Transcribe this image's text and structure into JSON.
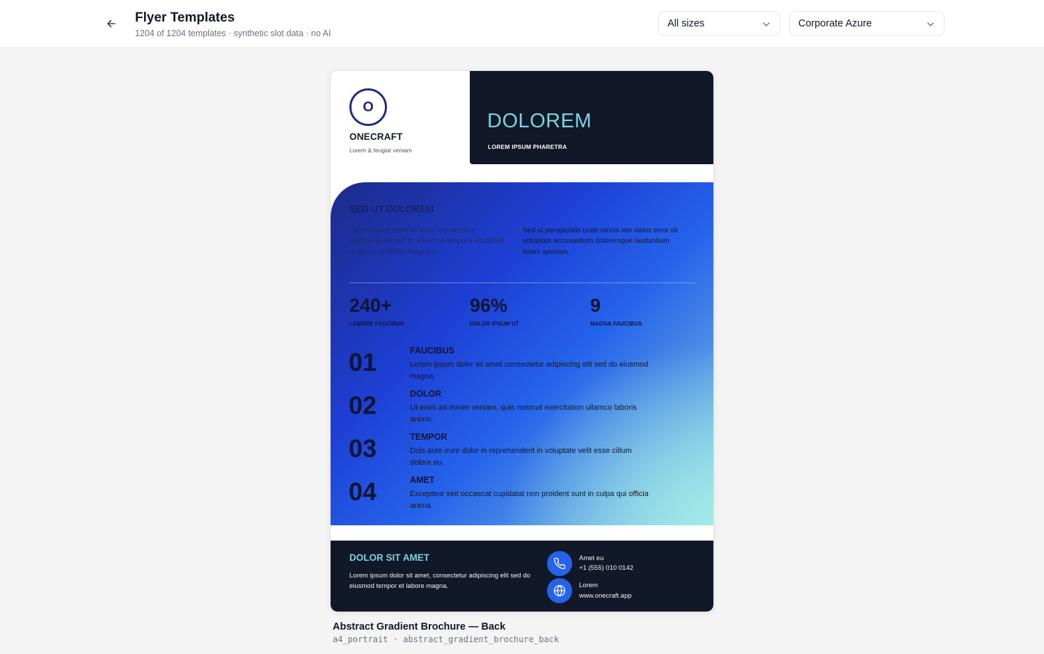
{
  "header": {
    "title": "Flyer Templates",
    "subtitle": "1204 of 1204 templates · synthetic slot data · no AI",
    "size_filter": "All sizes",
    "theme_filter": "Corporate Azure"
  },
  "flyer": {
    "logo_letter": "O",
    "brand_name": "ONECRAFT",
    "brand_tagline": "Lorem & feugiat veniam",
    "hero_title": "DOLOREM",
    "hero_subtitle": "LOREM IPSUM PHARETRA",
    "section_title": "SED UT DOLOREM",
    "section_col1": "Lorem ipsum dolor sit amet, consectetur adipiscing elit sed do eiusmod tempora incididunt ut labore et dolore magnam.",
    "section_col2": "Sed ut perspiciatis unde omnis iste natus error sit voluptate accusantium doloremque laudantium totam aperiam.",
    "stats": [
      {
        "value": "240+",
        "label": "LABORE FAUCIBUS"
      },
      {
        "value": "96%",
        "label": "DOLOR IPSUM UT"
      },
      {
        "value": "9",
        "label": "MAGNA FAUCIBUS"
      }
    ],
    "steps": [
      {
        "number": "01",
        "heading": "FAUCIBUS",
        "text": "Lorem ipsum dolor sit amet consectetur adipiscing elit sed do eiusmod magna."
      },
      {
        "number": "02",
        "heading": "DOLOR",
        "text": "Ut enim ad minim veniam, quis nostrud exercitation ullamco laboris animo."
      },
      {
        "number": "03",
        "heading": "TEMPOR",
        "text": "Duis aute irure dolor in reprehenderit in voluptate velit esse cillum dolore eu."
      },
      {
        "number": "04",
        "heading": "AMET",
        "text": "Excepteur sint occaecat cupidatat non proident sunt in culpa qui officia anima."
      }
    ],
    "footer_title": "DOLOR SIT AMET",
    "footer_text": "Lorem ipsum dolor sit amet, consectetur adipiscing elit sed do eiusmod tempor et labore magna.",
    "contacts": [
      {
        "icon": "phone-icon",
        "label": "Amet eu",
        "value": "+1 (555) 010 0142"
      },
      {
        "icon": "globe-icon",
        "label": "Lorem",
        "value": "www.onecraft.app"
      }
    ]
  },
  "caption": {
    "title": "Abstract Gradient Brochure — Back",
    "meta": "a4_portrait · abstract_gradient_brochure_back"
  },
  "colors": {
    "navy": "#111827",
    "accent_cyan": "#7dd3e0",
    "azure": "#2563eb",
    "deep_blue": "#1e2a8a"
  }
}
